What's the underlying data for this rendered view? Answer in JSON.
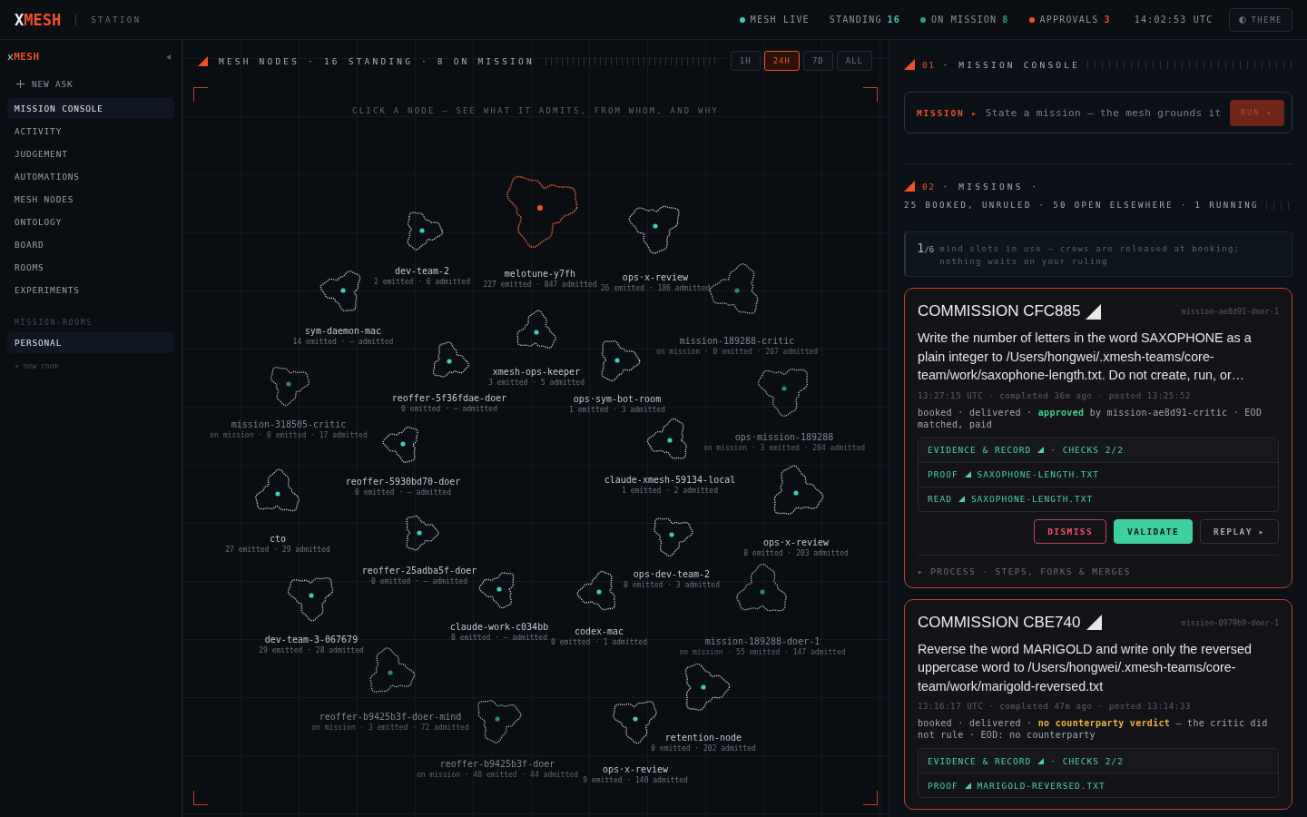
{
  "header": {
    "logo_initial": "X",
    "logo_rest": "MESH",
    "subtitle": "STATION",
    "status": [
      {
        "kind": "dot",
        "label": "MESH LIVE",
        "color": "#3ecfb4"
      },
      {
        "kind": "count",
        "label": "STANDING",
        "value": "16",
        "color": "#3ecfb4"
      },
      {
        "kind": "dot_count",
        "label": "ON MISSION",
        "value": "8",
        "color": "#2f9e88"
      },
      {
        "kind": "dot_count",
        "label": "APPROVALS",
        "value": "3",
        "color": "#f0502a"
      }
    ],
    "clock": "14:02:53 UTC",
    "theme_button": "THEME"
  },
  "sidebar": {
    "logo_initial": "x",
    "logo_rest": "MESH",
    "new_ask": "NEW ASK",
    "items": [
      {
        "label": "MISSION CONSOLE",
        "selected": true
      },
      {
        "label": "ACTIVITY",
        "selected": false
      },
      {
        "label": "JUDGEMENT",
        "selected": false
      },
      {
        "label": "AUTOMATIONS",
        "selected": false
      },
      {
        "label": "MESH NODES",
        "selected": false
      },
      {
        "label": "ONTOLOGY",
        "selected": false
      },
      {
        "label": "BOARD",
        "selected": false
      },
      {
        "label": "ROOMS",
        "selected": false
      },
      {
        "label": "EXPERIMENTS",
        "selected": false
      }
    ],
    "rooms_heading": "MISSION-ROOMS",
    "rooms": [
      {
        "label": "PERSONAL",
        "selected": true
      }
    ],
    "new_room": "+ new room"
  },
  "mesh": {
    "title": "MESH NODES · 16 STANDING · 8 ON MISSION",
    "ranges": [
      {
        "label": "1H",
        "selected": false
      },
      {
        "label": "24H",
        "selected": true
      },
      {
        "label": "7D",
        "selected": false
      },
      {
        "label": "ALL",
        "selected": false
      }
    ],
    "hint": "CLICK A NODE — SEE WHAT IT ADMITS, FROM WHOM, AND WHY",
    "nodes": [
      {
        "name": "dev-team-2",
        "stats": "2 emitted · 6 admitted",
        "on_mission": false,
        "selected": false
      },
      {
        "name": "melotune-y7fh",
        "stats": "227 emitted · 847 admitted",
        "on_mission": false,
        "selected": true
      },
      {
        "name": "ops·x-review",
        "stats": "26 emitted · 186 admitted",
        "on_mission": false,
        "selected": false
      },
      {
        "name": "sym-daemon-mac",
        "stats": "14 emitted · — admitted",
        "on_mission": false,
        "selected": false
      },
      {
        "name": "mission-189288-critic",
        "stats": "on mission · 0 emitted · 207 admitted",
        "on_mission": true,
        "selected": false
      },
      {
        "name": "xmesh-ops-keeper",
        "stats": "3 emitted · 5 admitted",
        "on_mission": false,
        "selected": false
      },
      {
        "name": "reoffer-5f36fdae-doer",
        "stats": "0 emitted · — admitted",
        "on_mission": false,
        "selected": false
      },
      {
        "name": "ops·sym-bot-room",
        "stats": "1 emitted · 3 admitted",
        "on_mission": false,
        "selected": false
      },
      {
        "name": "mission-318505-critic",
        "stats": "on mission · 0 emitted · 17 admitted",
        "on_mission": true,
        "selected": false
      },
      {
        "name": "ops·mission-189288",
        "stats": "on mission · 3 emitted · 204 admitted",
        "on_mission": true,
        "selected": false
      },
      {
        "name": "reoffer-5930bd70-doer",
        "stats": "0 emitted · — admitted",
        "on_mission": false,
        "selected": false
      },
      {
        "name": "claude-xmesh-59134-local",
        "stats": "1 emitted · 2 admitted",
        "on_mission": false,
        "selected": false
      },
      {
        "name": "cto",
        "stats": "27 emitted · 29 admitted",
        "on_mission": false,
        "selected": false
      },
      {
        "name": "ops·x-review",
        "stats": "0 emitted · 203 admitted",
        "on_mission": false,
        "selected": false
      },
      {
        "name": "reoffer-25adba5f-doer",
        "stats": "0 emitted · — admitted",
        "on_mission": false,
        "selected": false
      },
      {
        "name": "ops·dev-team-2",
        "stats": "0 emitted · 3 admitted",
        "on_mission": false,
        "selected": false
      },
      {
        "name": "dev-team-3-067679",
        "stats": "29 emitted · 28 admitted",
        "on_mission": false,
        "selected": false
      },
      {
        "name": "claude-work-c034bb",
        "stats": "0 emitted · — admitted",
        "on_mission": false,
        "selected": false
      },
      {
        "name": "codex-mac",
        "stats": "0 emitted · 1 admitted",
        "on_mission": false,
        "selected": false
      },
      {
        "name": "mission-189288-doer-1",
        "stats": "on mission · 55 emitted · 147 admitted",
        "on_mission": true,
        "selected": false
      },
      {
        "name": "reoffer-b9425b3f-doer-mind",
        "stats": "on mission · 3 emitted · 72 admitted",
        "on_mission": true,
        "selected": false
      },
      {
        "name": "retention-node",
        "stats": "0 emitted · 202 admitted",
        "on_mission": false,
        "selected": false
      },
      {
        "name": "reoffer-b9425b3f-doer",
        "stats": "on mission · 40 emitted · 44 admitted",
        "on_mission": true,
        "selected": false
      },
      {
        "name": "ops·x-review",
        "stats": "9 emitted · 140 admitted",
        "on_mission": false,
        "selected": false
      }
    ]
  },
  "console": {
    "section_1": {
      "number": "01",
      "title": "· MISSION CONSOLE"
    },
    "mission_label": "MISSION ▸",
    "mission_placeholder": "State a mission — the mesh grounds it",
    "run_button": "RUN ▸",
    "section_2": {
      "number": "02",
      "title": "· MISSIONS ·"
    },
    "summary": "25 BOOKED, UNRULED · 50 OPEN ELSEWHERE · 1 RUNNING",
    "slots": {
      "used": "1",
      "total": "/6",
      "text": "mind slots in use — crews are released at booking; nothing waits on your ruling"
    },
    "commissions": [
      {
        "title": "COMMISSION CFC885",
        "mission_id": "mission-ae8d91-doer-1",
        "body": "Write the number of letters in the word SAXOPHONE as a plain integer to /Users/hongwei/.xmesh-teams/core-team/work/saxophone-length.txt. Do not create, run, or…",
        "meta": "13:27:15 UTC · completed 36m ago · posted 13:25:52",
        "approved": true,
        "status": "booked · delivered · **approved** by mission-ae8d91-critic · EOD matched, paid",
        "evidence": [
          {
            "label": "EVIDENCE & RECORD",
            "value": "· CHECKS 2/2"
          },
          {
            "label": "PROOF",
            "value": "SAXOPHONE-LENGTH.TXT"
          },
          {
            "label": "READ",
            "value": "SAXOPHONE-LENGTH.TXT"
          }
        ],
        "buttons": [
          {
            "kind": "dismiss",
            "label": "DISMISS"
          },
          {
            "kind": "validate",
            "label": "VALIDATE"
          },
          {
            "kind": "replay",
            "label": "REPLAY ▸"
          }
        ],
        "process": "▸ PROCESS · STEPS, FORKS & MERGES"
      },
      {
        "title": "COMMISSION CBE740",
        "mission_id": "mission-0979b9-doer-1",
        "body": "Reverse the word MARIGOLD and write only the reversed uppercase word to /Users/hongwei/.xmesh-teams/core-team/work/marigold-reversed.txt",
        "meta": "13:16:17 UTC · completed 47m ago · posted 13:14:33",
        "approved": false,
        "status": "booked · delivered · **no counterparty verdict** — the critic did not rule · EOD: no counterparty",
        "evidence": [
          {
            "label": "EVIDENCE & RECORD",
            "value": "· CHECKS 2/2"
          },
          {
            "label": "PROOF",
            "value": "MARIGOLD-REVERSED.TXT"
          }
        ]
      }
    ]
  }
}
